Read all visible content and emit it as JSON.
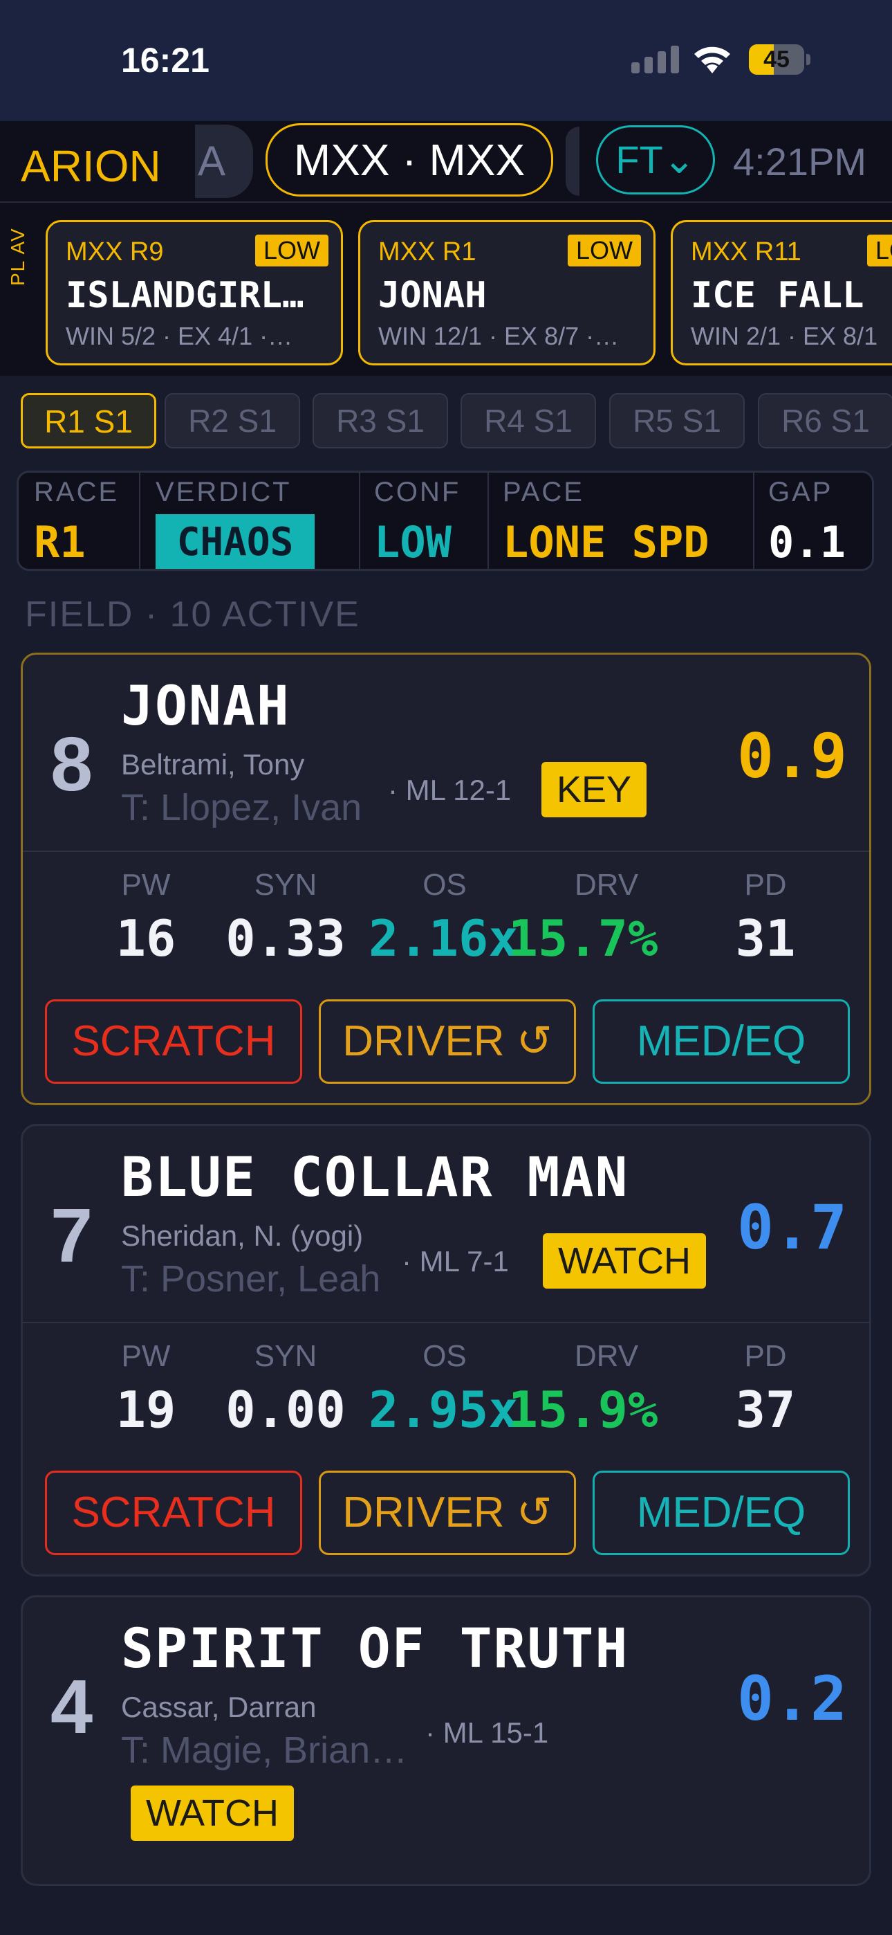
{
  "status_bar": {
    "time": "16:21",
    "battery": "45",
    "battery_level": 0.45
  },
  "top_bar": {
    "brand": "ARION",
    "left_tab": "A",
    "track": "MXX · MXX",
    "filter": "FT⌄",
    "clock": "4:21PM"
  },
  "race_strip": {
    "side_label": "PL AV",
    "cards": [
      {
        "race": "MXX R9",
        "confidence": "LOW",
        "name": "ISLANDGIRL…",
        "odds": "WIN 5/2 · EX 4/1 ·…"
      },
      {
        "race": "MXX R1",
        "confidence": "LOW",
        "name": "JONAH",
        "odds": "WIN 12/1 · EX 8/7 ·…"
      },
      {
        "race": "MXX R11",
        "confidence": "LOW",
        "name": "ICE FALL",
        "odds": "WIN 2/1 · EX 8/1"
      }
    ]
  },
  "segments": [
    "R1 S1",
    "R2 S1",
    "R3 S1",
    "R4 S1",
    "R5 S1",
    "R6 S1"
  ],
  "summary": {
    "race_label": "RACE",
    "race": "R1",
    "verdict_label": "VERDICT",
    "verdict": "CHAOS",
    "conf_label": "CONF",
    "conf": "LOW",
    "pace_label": "PACE",
    "pace": "LONE SPD",
    "gap_label": "GAP",
    "gap": "0.1"
  },
  "field": {
    "header": "FIELD · 10 ACTIVE"
  },
  "metric_labels": {
    "pw": "PW",
    "syn": "SYN",
    "os": "OS",
    "drv": "DRV",
    "pd": "PD"
  },
  "buttons": {
    "scratch": "SCRATCH",
    "driver": "DRIVER ↺",
    "med": "MED/EQ"
  },
  "horses": [
    {
      "pgm": "8",
      "name": "JONAH",
      "driver": "Beltrami, Tony",
      "trainer": "T: Llopez, Ivan",
      "ml": "· ML 12-1",
      "badge": "KEY",
      "score": "0.9",
      "pw": "16",
      "syn": "0.33",
      "os": "2.16x",
      "drv": "15.7%",
      "pd": "31"
    },
    {
      "pgm": "7",
      "name": "BLUE COLLAR MAN",
      "driver": "Sheridan, N. (yogi)",
      "trainer": "T: Posner, Leah",
      "ml": "· ML 7-1",
      "badge": "WATCH",
      "score": "0.7",
      "pw": "19",
      "syn": "0.00",
      "os": "2.95x",
      "drv": "15.9%",
      "pd": "37"
    },
    {
      "pgm": "4",
      "name": "SPIRIT OF TRUTH",
      "driver": "Cassar, Darran",
      "trainer": "T: Magie, Brian…",
      "ml": "· ML 15-1",
      "badge": "WATCH",
      "score": "0.2"
    }
  ],
  "colors": {
    "gold": "#f5b800",
    "teal": "#13b3b3",
    "green": "#19c45a",
    "blue": "#3e8ef0",
    "red": "#e32d1e",
    "bg": "#181b2c"
  }
}
